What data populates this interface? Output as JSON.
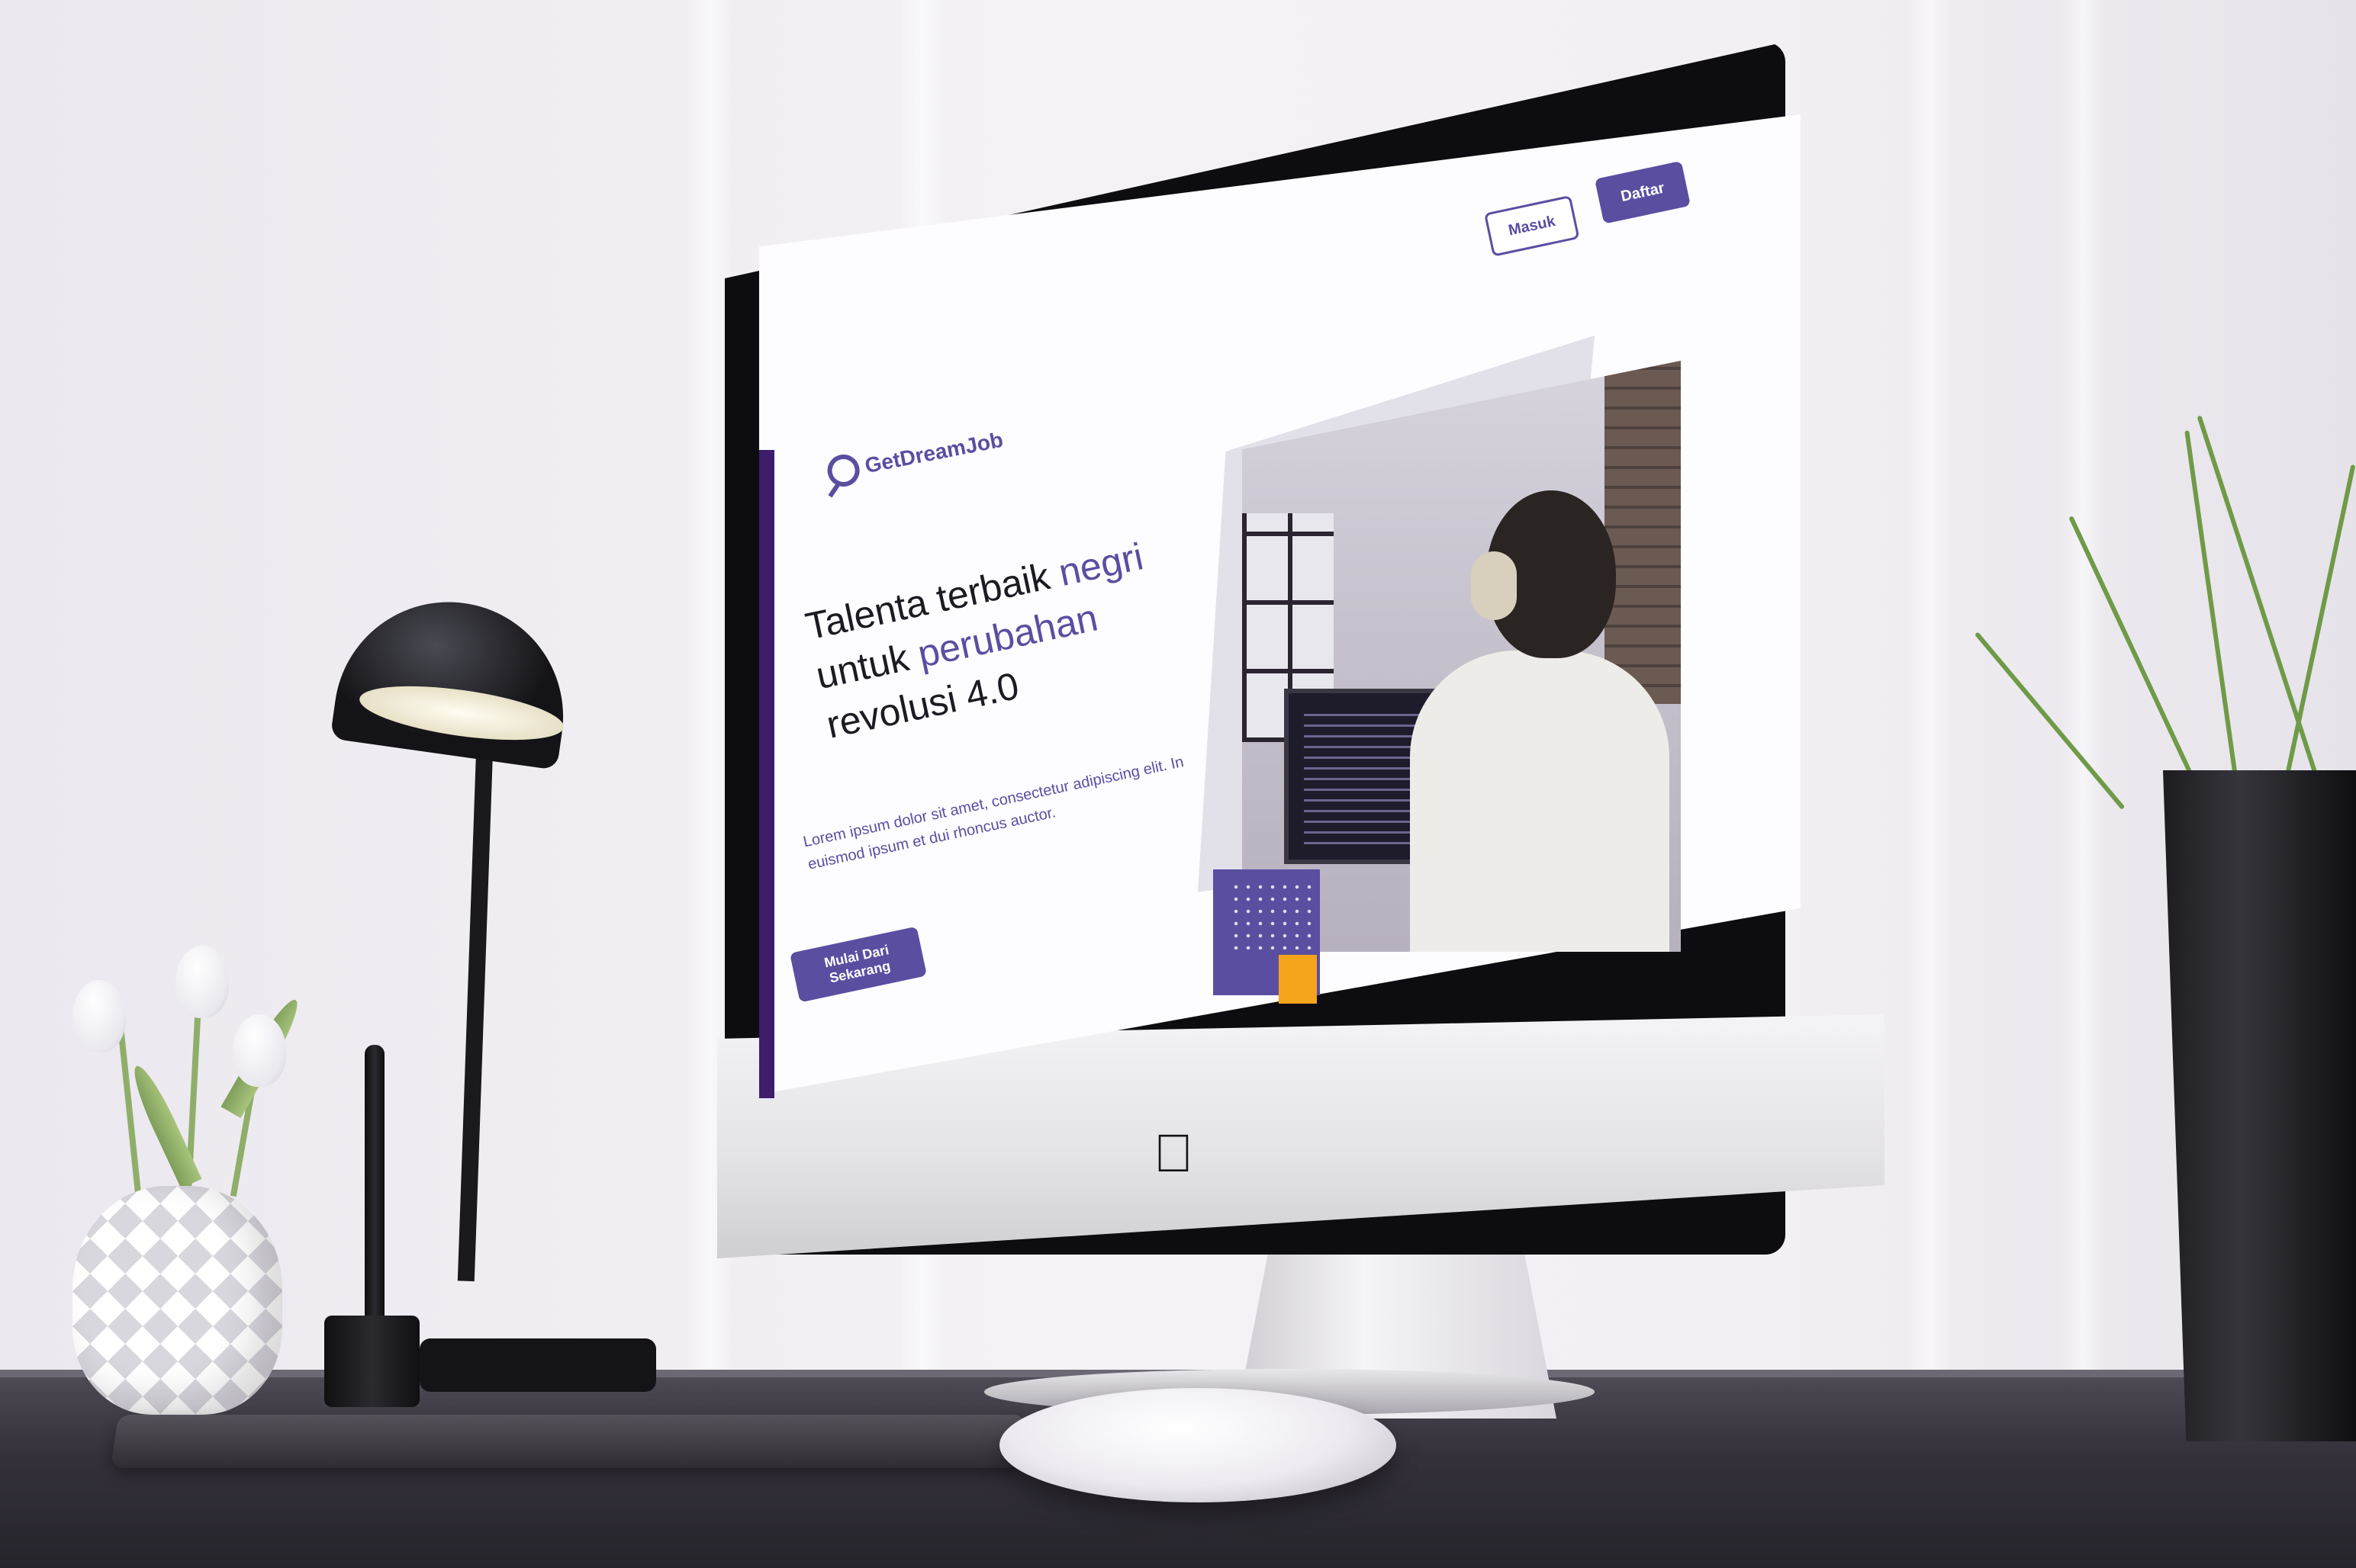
{
  "website": {
    "brand": {
      "name_part1": "Get",
      "name_part2": "Dream",
      "name_part3": "Job"
    },
    "nav": {
      "login_label": "Masuk",
      "register_label": "Daftar"
    },
    "hero": {
      "title_line1_plain": "Talenta terbaik ",
      "title_line1_accent": "negri",
      "title_line2_plain": "untuk ",
      "title_line2_accent": "perubahan",
      "title_line3": "revolusi 4.0",
      "description": "Lorem ipsum dolor sit amet, consectetur adipiscing elit. In euismod ipsum et dui rhoncus auctor.",
      "cta_label": "Mulai Dari Sekarang"
    },
    "colors": {
      "primary": "#5a4ea1",
      "accent_orange": "#f4a51c",
      "text_dark": "#1c1a22"
    }
  },
  "icons": {
    "logo": "magnifier-logo-icon",
    "device_brand": "apple-logo-icon"
  }
}
